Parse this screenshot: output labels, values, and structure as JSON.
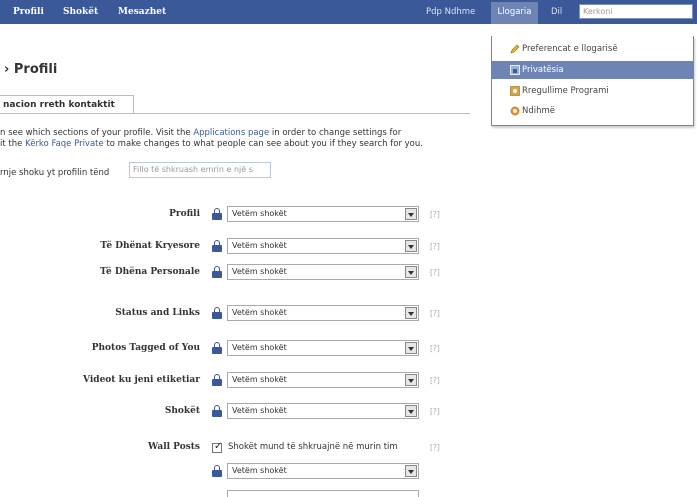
{
  "topbar": {
    "nav": [
      "Profili",
      "Shokët",
      "Mesazhet"
    ],
    "user": "Pdp Ndhme",
    "account": "Llogaria",
    "language": "Dil",
    "search_placeholder": "Kerkoni"
  },
  "account_menu": {
    "items": [
      {
        "label": "Preferencat e llogarisë",
        "icon": "pencil-icon"
      },
      {
        "label": "Privatësia",
        "icon": "privacy-icon",
        "active": true
      },
      {
        "label": "Rregullime Programi",
        "icon": "application-icon"
      },
      {
        "label": "Ndihmë",
        "icon": "help-icon"
      }
    ]
  },
  "page": {
    "title": "› Profili",
    "tab": "nacion rreth kontaktit",
    "intro_line1_a": "n see which sections of your profile. Visit the ",
    "intro_line1_link": "Applications page",
    "intro_line1_b": " in order to change settings for",
    "intro_line2_a": "it the ",
    "intro_line2_link": "Kërko Faqe Private",
    "intro_line2_b": " to make changes to what people can see about you if they search for you.",
    "preview_label": "rnje shoku yt profilin tënd",
    "preview_placeholder": "Fillo të shkruash emrin e një s"
  },
  "settings": [
    {
      "label": "Profili",
      "value": "Vetëm shokët"
    },
    {
      "label": "Të Dhënat Kryesore",
      "value": "Vetëm shokët"
    },
    {
      "label": "Të Dhëna Personale",
      "value": "Vetëm shokët"
    },
    {
      "label": "Status and Links",
      "value": "Vetëm shokët"
    },
    {
      "label": "Photos Tagged of You",
      "value": "Vetëm shokët"
    },
    {
      "label": "Videot ku jeni etiketiar",
      "value": "Vetëm shokët"
    },
    {
      "label": "Shokët",
      "value": "Vetëm shokët"
    }
  ],
  "wall_posts": {
    "label": "Wall Posts",
    "checkbox_label": "Shokët mund të shkruajnë në murin tim",
    "value": "Vetëm shokët"
  },
  "help_text": "[?]",
  "colors": {
    "brand": "#3b5998",
    "active_menu": "#6d84b4"
  }
}
